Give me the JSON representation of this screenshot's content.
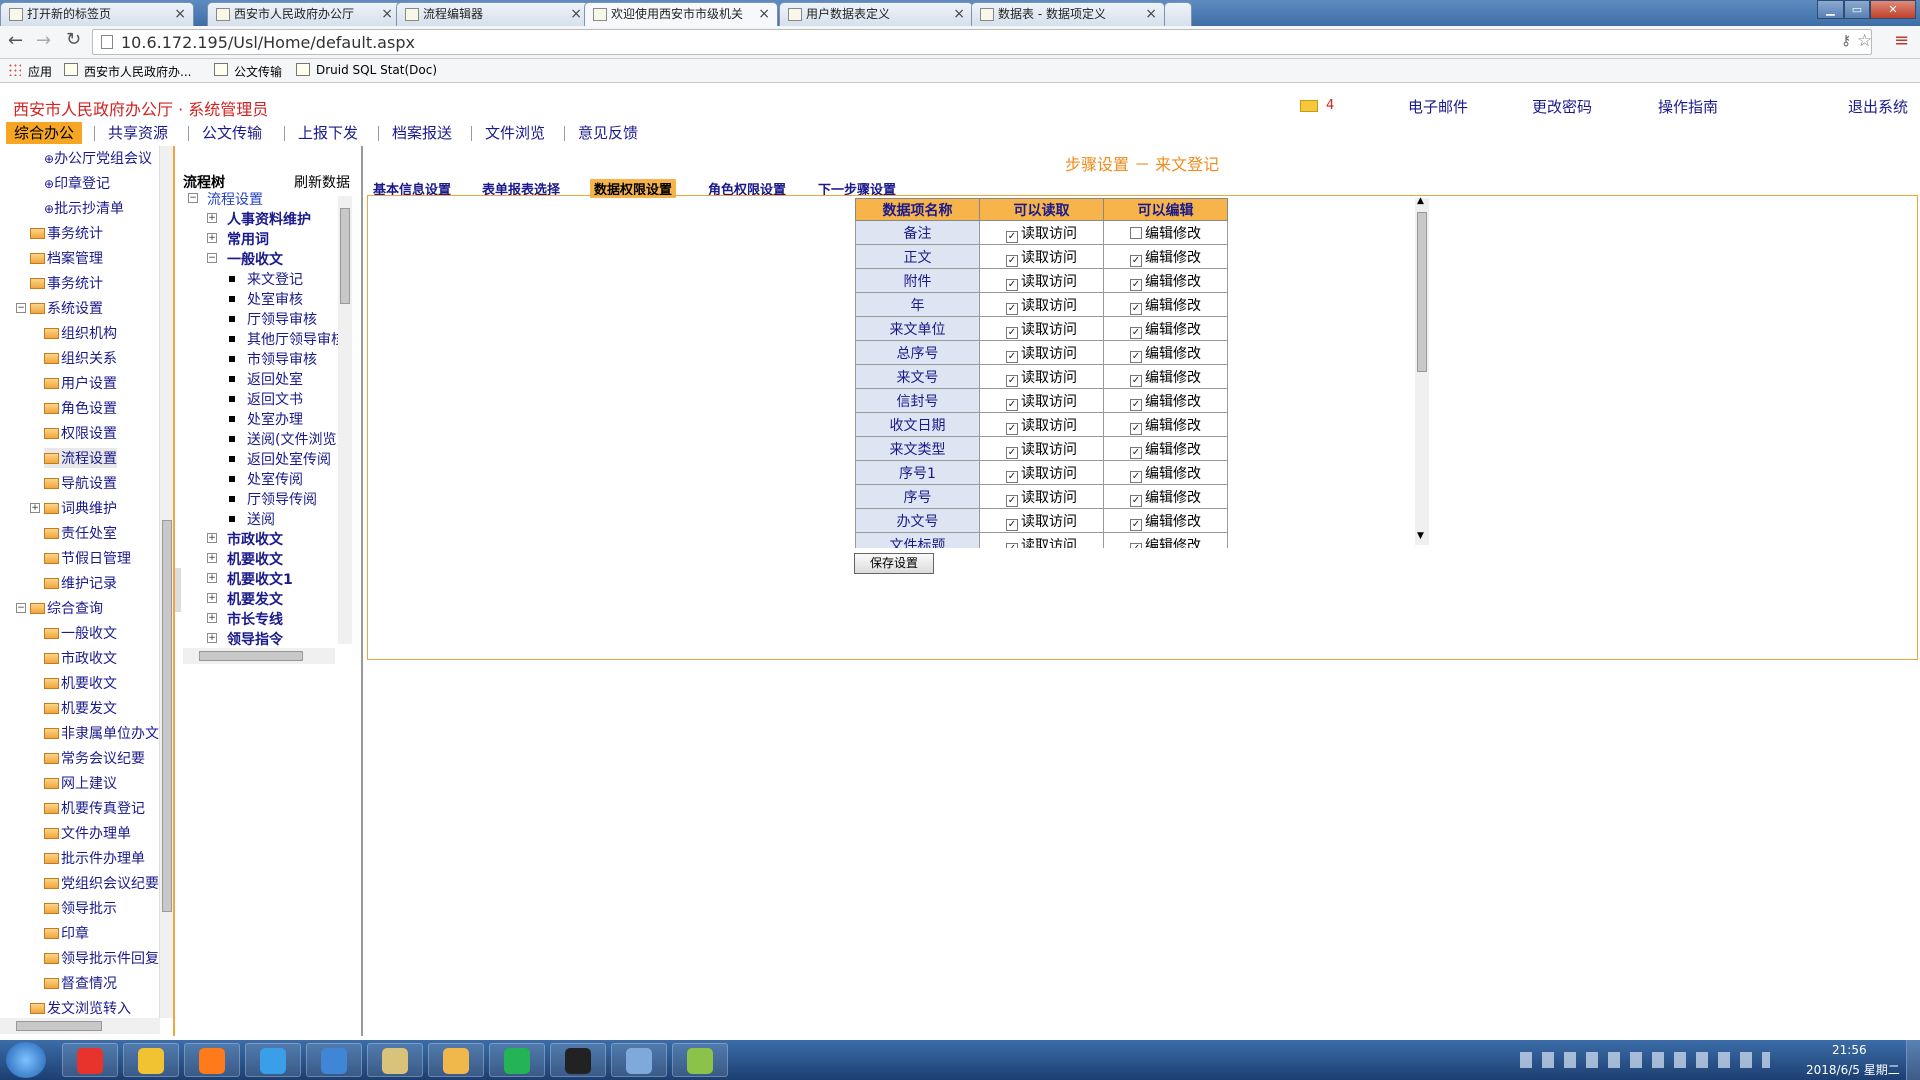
{
  "browser": {
    "tabs": [
      {
        "title": "打开新的标签页"
      },
      {
        "title": "西安市人民政府办公厅"
      },
      {
        "title": "流程编辑器"
      },
      {
        "title": "欢迎使用西安市市级机关"
      },
      {
        "title": "用户数据表定义"
      },
      {
        "title": "数据表 - 数据项定义"
      }
    ],
    "url": "10.6.172.195/Usl/Home/default.aspx",
    "bookmarks": [
      "应用",
      "西安市人民政府办...",
      "公文传输",
      "Druid SQL Stat(Doc)"
    ]
  },
  "header": {
    "title": "西安市人民政府办公厅 · 系统管理员",
    "mail_count": "4",
    "links": [
      "电子邮件",
      "更改密码",
      "操作指南",
      "退出系统"
    ]
  },
  "menu": [
    "综合办公",
    "共享资源",
    "公文传输",
    "上报下发",
    "档案报送",
    "文件浏览",
    "意见反馈"
  ],
  "leftnav": [
    "办公厅党组会议",
    "印章登记",
    "批示抄清单",
    "事务统计",
    "档案管理",
    "事务统计",
    "系统设置",
    "组织机构",
    "组织关系",
    "用户设置",
    "角色设置",
    "权限设置",
    "流程设置",
    "导航设置",
    "词典维护",
    "责任处室",
    "节假日管理",
    "维护记录",
    "综合查询",
    "一般收文",
    "市政收文",
    "机要收文",
    "机要发文",
    "非隶属单位办文",
    "常务会议纪要",
    "网上建议",
    "机要传真登记",
    "文件办理单",
    "批示件办理单",
    "党组织会议纪要",
    "领导批示",
    "印章",
    "领导批示件回复",
    "督查情况",
    "发文浏览转入"
  ],
  "tree": {
    "header": "流程树",
    "refresh": "刷新数据",
    "root": "流程设置",
    "groups_top": [
      "人事资料维护",
      "常用词",
      "一般收文"
    ],
    "leaves": [
      "来文登记",
      "处室审核",
      "厅领导审核",
      "其他厅领导审核",
      "市领导审核",
      "返回处室",
      "返回文书",
      "处室办理",
      "送阅(文件浏览)",
      "返回处室传阅",
      "处室传阅",
      "厅领导传阅",
      "送阅"
    ],
    "groups_bottom": [
      "市政收文",
      "机要收文",
      "机要收文1",
      "机要发文",
      "市长专线",
      "领导指令"
    ]
  },
  "main": {
    "step_title": "步骤设置 － 来文登记",
    "tabs": [
      "基本信息设置",
      "表单报表选择",
      "数据权限设置",
      "角色权限设置",
      "下一步骤设置"
    ],
    "active_tab": 2,
    "columns": [
      "数据项名称",
      "可以读取",
      "可以编辑"
    ],
    "rows": [
      {
        "name": "备注",
        "read": true,
        "edit": false
      },
      {
        "name": "正文",
        "read": true,
        "edit": true
      },
      {
        "name": "附件",
        "read": true,
        "edit": true
      },
      {
        "name": "年",
        "read": true,
        "edit": true
      },
      {
        "name": "来文单位",
        "read": true,
        "edit": true
      },
      {
        "name": "总序号",
        "read": true,
        "edit": true
      },
      {
        "name": "来文号",
        "read": true,
        "edit": true
      },
      {
        "name": "信封号",
        "read": true,
        "edit": true
      },
      {
        "name": "收文日期",
        "read": true,
        "edit": true
      },
      {
        "name": "来文类型",
        "read": true,
        "edit": true
      },
      {
        "name": "序号1",
        "read": true,
        "edit": true
      },
      {
        "name": "序号",
        "read": true,
        "edit": true
      },
      {
        "name": "办文号",
        "read": true,
        "edit": true
      },
      {
        "name": "文件标题",
        "read": true,
        "edit": true
      }
    ],
    "read_label": "读取访问",
    "edit_label": "编辑修改",
    "save_button": "保存设置"
  },
  "taskbar": {
    "time": "21:56",
    "date": "2018/6/5 星期二"
  }
}
